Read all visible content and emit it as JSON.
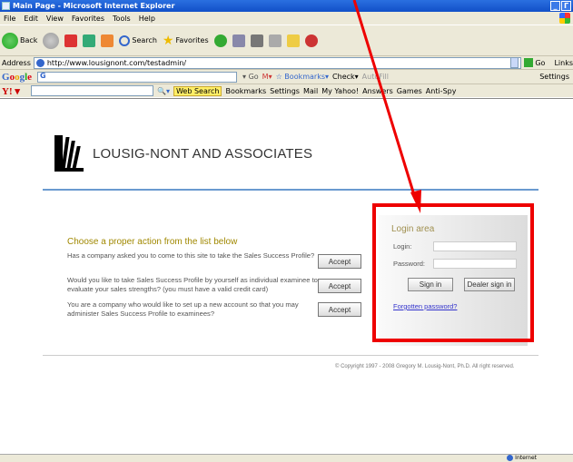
{
  "window": {
    "title": "Main Page - Microsoft Internet Explorer",
    "controls": [
      "_",
      "Г"
    ]
  },
  "menu": [
    "File",
    "Edit",
    "View",
    "Favorites",
    "Tools",
    "Help"
  ],
  "toolbar": {
    "back": "Back",
    "search": "Search",
    "favorites": "Favorites"
  },
  "address": {
    "label": "Address",
    "url": "http://www.lousignont.com/testadmin/",
    "go": "Go",
    "links": "Links"
  },
  "google": {
    "settings": "Settings"
  },
  "yahoo": {
    "web_search": "Web Search",
    "bookmarks": "Bookmarks",
    "settings": "Settings",
    "mail": "Mail",
    "my_yahoo": "My Yahoo!",
    "answers": "Answers",
    "games": "Games",
    "antispy": "Anti-Spy"
  },
  "page": {
    "company": "LOUSIG-NONT AND ASSOCIATES",
    "choose_title": "Choose a proper action from the list below",
    "actions": [
      {
        "text": "Has a company asked you to come to this site to take the Sales Success Profile?",
        "button": "Accept"
      },
      {
        "text": "Would you like to take Sales Success Profile by yourself as individual examinee to evaluate your sales strengths? (you must have a valid credit card)",
        "button": "Accept"
      },
      {
        "text": "You are a company who would like to set up a new account so that you may administer Sales Success Profile to examinees?",
        "button": "Accept"
      }
    ],
    "login": {
      "title": "Login area",
      "login_label": "Login:",
      "password_label": "Password:",
      "sign_in": "Sign in",
      "dealer_sign_in": "Dealer sign in",
      "forgotten": "Forgotten password?"
    },
    "copyright": "© Copyright 1997 - 2008 Gregory M. Lousig-Nont, Ph.D. All right reserved."
  },
  "status": {
    "zone": "Internet"
  },
  "annotation_color": "#e00000"
}
